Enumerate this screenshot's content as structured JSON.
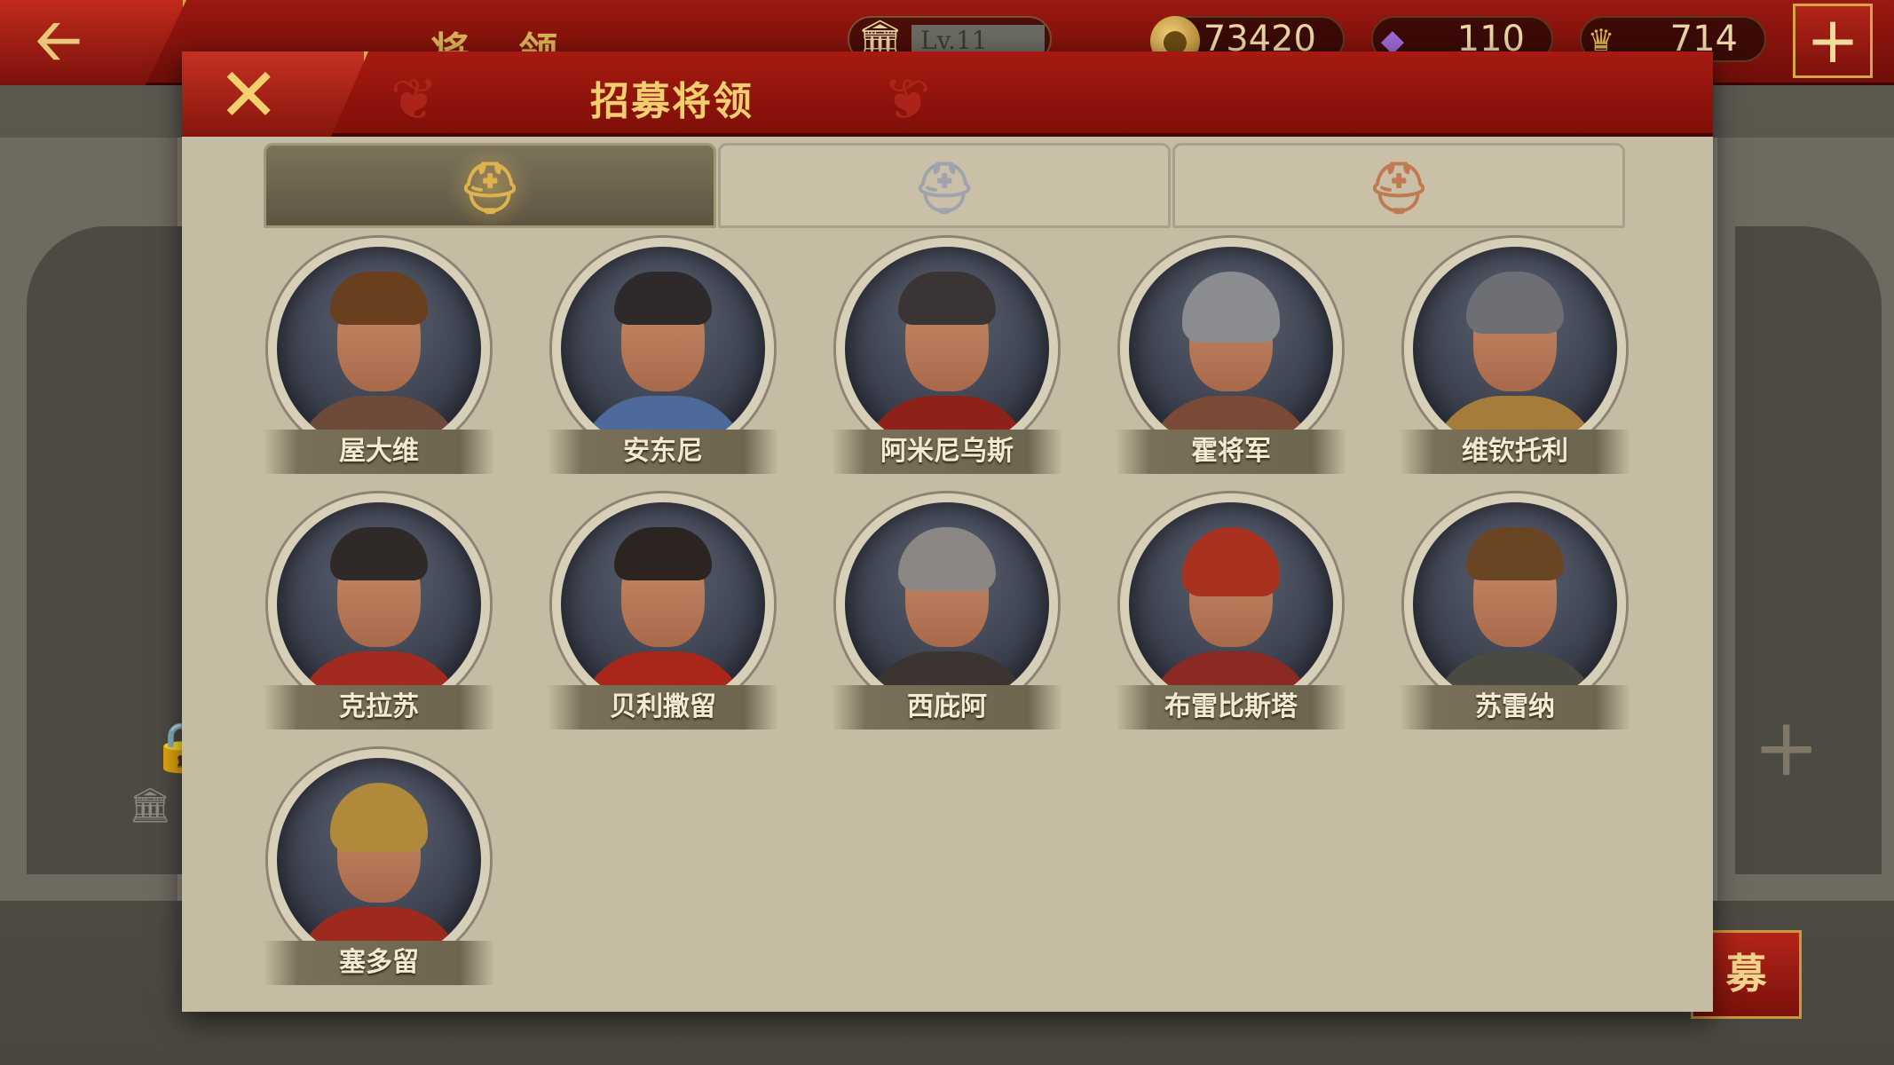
{
  "background": {
    "title": "将 领",
    "level": "Lv.11",
    "resources": {
      "gold": "73420",
      "gems": "110",
      "honor": "714"
    },
    "recruit_label": "募"
  },
  "modal": {
    "title": "招募将领",
    "tabs": [
      {
        "name": "gold-tier",
        "icon": "spartan-helmet-laurel-icon",
        "color": "#e0b24e",
        "active": true
      },
      {
        "name": "silver-tier",
        "icon": "spartan-helmet-laurel-icon",
        "color": "#9fa3ad",
        "active": false
      },
      {
        "name": "bronze-tier",
        "icon": "spartan-helmet-laurel-icon",
        "color": "#c07a52",
        "active": false
      }
    ],
    "generals": [
      {
        "name": "屋大维"
      },
      {
        "name": "安东尼"
      },
      {
        "name": "阿米尼乌斯"
      },
      {
        "name": "霍将军"
      },
      {
        "name": "维钦托利"
      },
      {
        "name": "克拉苏"
      },
      {
        "name": "贝利撒留"
      },
      {
        "name": "西庇阿"
      },
      {
        "name": "布雷比斯塔"
      },
      {
        "name": "苏雷纳"
      },
      {
        "name": "塞多留"
      }
    ]
  }
}
